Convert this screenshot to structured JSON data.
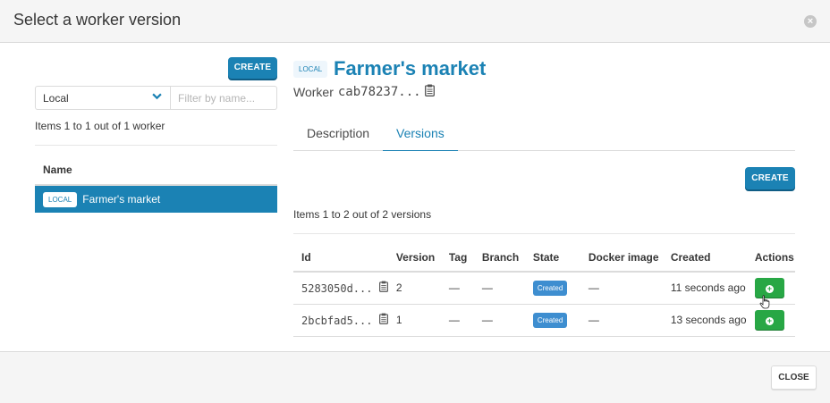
{
  "modal": {
    "title": "Select a worker version",
    "close_label": "CLOSE"
  },
  "left": {
    "create_label": "CREATE",
    "repo_select": "Local",
    "filter_placeholder": "Filter by name...",
    "count_text": "Items 1 to 1 out of 1 worker",
    "table_header": "Name",
    "rows": [
      {
        "tag": "LOCAL",
        "name": "Farmer's market"
      }
    ]
  },
  "worker": {
    "tag": "LOCAL",
    "title": "Farmer's market",
    "sub_label": "Worker",
    "hash": "cab78237..."
  },
  "tabs": [
    {
      "label": "Description"
    },
    {
      "label": "Versions"
    }
  ],
  "versions": {
    "create_label": "CREATE",
    "count_text": "Items 1 to 2 out of 2 versions",
    "columns": [
      "Id",
      "Version",
      "Tag",
      "Branch",
      "State",
      "Docker image",
      "Created",
      "Actions"
    ],
    "rows": [
      {
        "id": "5283050d...",
        "version": "2",
        "tag": "—",
        "branch": "—",
        "state": "Created",
        "docker": "—",
        "created": "11 seconds ago"
      },
      {
        "id": "2bcbfad5...",
        "version": "1",
        "tag": "—",
        "branch": "—",
        "state": "Created",
        "docker": "—",
        "created": "13 seconds ago"
      }
    ]
  },
  "icons": {
    "close": "close-circle-icon",
    "chevron": "chevron-down-icon",
    "clipboard": "clipboard-icon",
    "add": "plus-circle-icon",
    "cursor": "hand-pointer-icon"
  },
  "colors": {
    "primary": "#1b82b4",
    "success": "#28a745",
    "state_badge": "#3e8ed0"
  }
}
